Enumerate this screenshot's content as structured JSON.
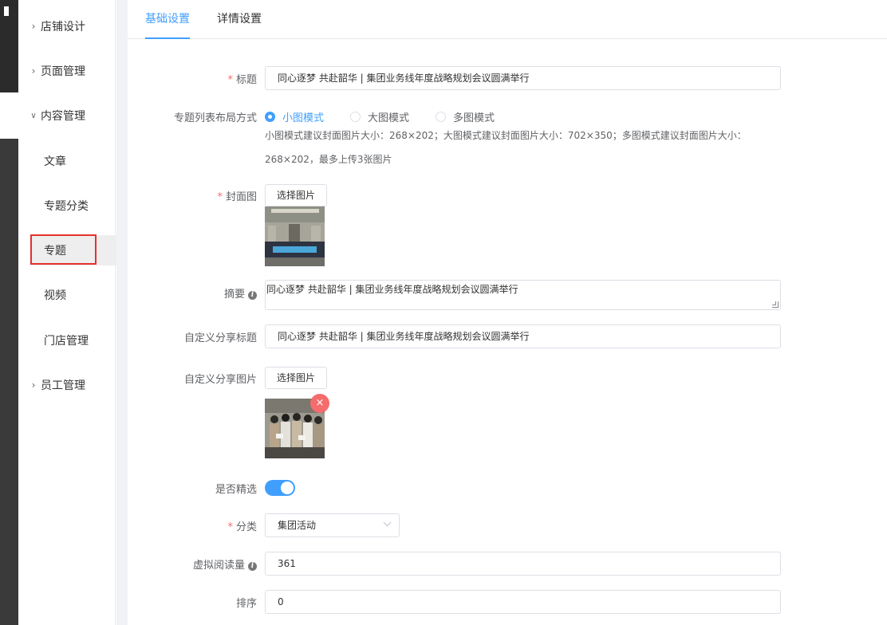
{
  "sidebar": {
    "groups": [
      {
        "label": "店铺设计"
      },
      {
        "label": "页面管理"
      },
      {
        "label": "内容管理"
      },
      {
        "label": "员工管理"
      }
    ],
    "content_items": [
      {
        "label": "文章"
      },
      {
        "label": "专题分类"
      },
      {
        "label": "专题"
      },
      {
        "label": "视频"
      },
      {
        "label": "门店管理"
      }
    ],
    "active_item": "专题"
  },
  "tabs": [
    {
      "label": "基础设置",
      "active": true
    },
    {
      "label": "详情设置",
      "active": false
    }
  ],
  "form": {
    "required_mark": "*",
    "title": {
      "label": "标题",
      "value": "同心逐梦 共赴韶华 | 集团业务线年度战略规划会议圆满举行"
    },
    "layout": {
      "label": "专题列表布局方式",
      "options": [
        "小图模式",
        "大图模式",
        "多图模式"
      ],
      "selected": "小图模式",
      "hint_line1": "小图模式建议封面图片大小：268×202；大图模式建议封面图片大小：702×350；多图模式建议封面图片大小：",
      "hint_line2": "268×202，最多上传3张图片"
    },
    "cover": {
      "label": "封面图",
      "button": "选择图片"
    },
    "summary": {
      "label": "摘要",
      "value": "同心逐梦 共赴韶华 | 集团业务线年度战略规划会议圆满举行"
    },
    "share_title": {
      "label": "自定义分享标题",
      "value": "同心逐梦 共赴韶华 | 集团业务线年度战略规划会议圆满举行"
    },
    "share_image": {
      "label": "自定义分享图片",
      "button": "选择图片",
      "remove_glyph": "×"
    },
    "featured": {
      "label": "是否精选",
      "on": true
    },
    "category": {
      "label": "分类",
      "value": "集团活动"
    },
    "virtual_reads": {
      "label": "虚拟阅读量",
      "value": "361"
    },
    "sort": {
      "label": "排序",
      "value": "0"
    }
  },
  "colors": {
    "accent": "#409eff",
    "required": "#f56c6c",
    "highlight_box": "#e5322d"
  },
  "icons": {
    "chevron_right": "›",
    "chevron_down": "∨",
    "info": "i"
  }
}
